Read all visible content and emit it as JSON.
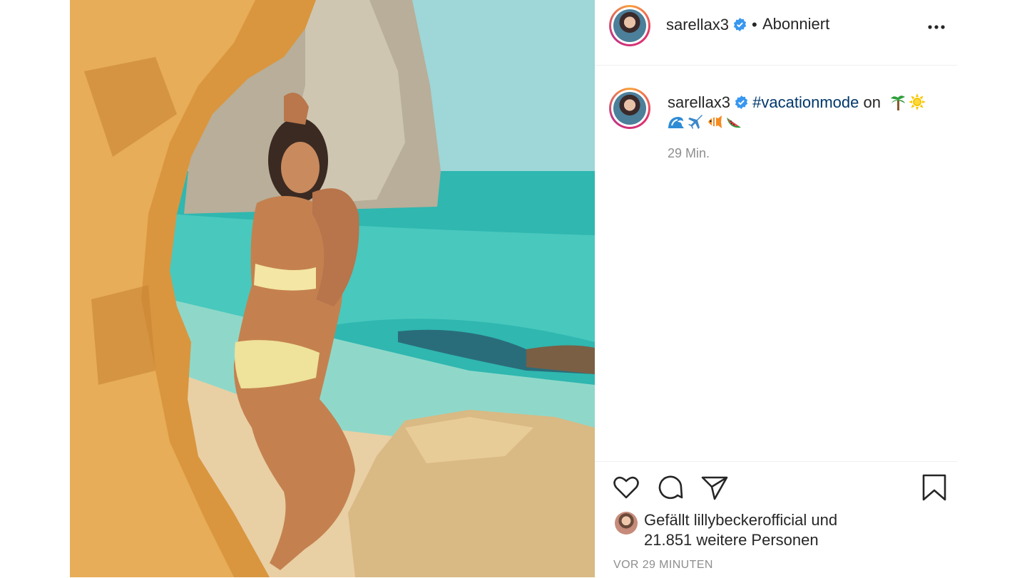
{
  "post": {
    "photo_icon": "beach-photo",
    "username": "sarellax3",
    "verified": true,
    "follow_status": "Abonniert",
    "separator": "•",
    "more_icon": "more-horizontal-icon",
    "more_label": "···"
  },
  "caption": {
    "username": "sarellax3",
    "hashtag": "#vacationmode",
    "text_after": " on",
    "emojis_line1": [
      "palm-tree-emoji",
      "sun-emoji"
    ],
    "emojis_line2": [
      "wave-emoji",
      "airplane-emoji",
      "fish-emoji",
      "watermelon-emoji"
    ],
    "time": "29 Min."
  },
  "actions": {
    "like_icon": "heart-icon",
    "comment_icon": "comment-icon",
    "share_icon": "send-icon",
    "save_icon": "bookmark-icon"
  },
  "likes": {
    "prefix": "Gefällt",
    "user": "lillybeckerofficial",
    "conj": "und",
    "others": "21.851 weitere Personen"
  },
  "timestamp": "VOR 29 MINUTEN",
  "colors": {
    "link": "#00376b",
    "verified": "#3897f0",
    "muted": "#8e8e8e"
  }
}
